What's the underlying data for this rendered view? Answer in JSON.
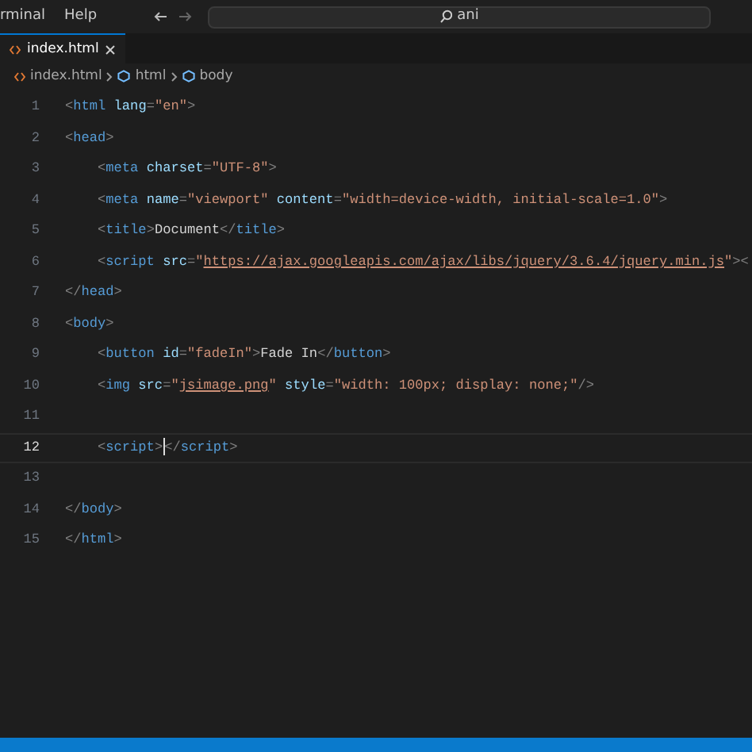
{
  "menu": [
    "rminal",
    "Help"
  ],
  "command_center": {
    "value": "ani"
  },
  "tabs": [
    {
      "label": "index.html",
      "selected": true
    }
  ],
  "breadcrumb": [
    "index.html",
    "html",
    "body"
  ],
  "lines": [
    {
      "number": "1",
      "selected": false,
      "tokens": [
        {
          "kind": "punct",
          "text": "<"
        },
        {
          "kind": "tag",
          "text": "html"
        },
        {
          "kind": "attr",
          "text": " lang"
        },
        {
          "kind": "punct",
          "text": "="
        },
        {
          "kind": "string",
          "text": "\"en\""
        },
        {
          "kind": "punct",
          "text": ">"
        }
      ]
    },
    {
      "number": "2",
      "selected": false,
      "tokens": [
        {
          "kind": "punct",
          "text": "<"
        },
        {
          "kind": "tag",
          "text": "head"
        },
        {
          "kind": "punct",
          "text": ">"
        }
      ]
    },
    {
      "number": "3",
      "selected": false,
      "tokens": [
        {
          "kind": "punct",
          "text": "    <"
        },
        {
          "kind": "tag",
          "text": "meta"
        },
        {
          "kind": "attr",
          "text": " charset"
        },
        {
          "kind": "punct",
          "text": "="
        },
        {
          "kind": "string",
          "text": "\"UTF-8\""
        },
        {
          "kind": "punct",
          "text": ">"
        }
      ]
    },
    {
      "number": "4",
      "selected": false,
      "tokens": [
        {
          "kind": "punct",
          "text": "    <"
        },
        {
          "kind": "tag",
          "text": "meta"
        },
        {
          "kind": "attr",
          "text": " name"
        },
        {
          "kind": "punct",
          "text": "="
        },
        {
          "kind": "string",
          "text": "\"viewport\""
        },
        {
          "kind": "attr",
          "text": " content"
        },
        {
          "kind": "punct",
          "text": "="
        },
        {
          "kind": "string",
          "text": "\"width=device-width, initial-scale=1.0\""
        },
        {
          "kind": "punct",
          "text": ">"
        }
      ]
    },
    {
      "number": "5",
      "selected": false,
      "tokens": [
        {
          "kind": "punct",
          "text": "    <"
        },
        {
          "kind": "tag",
          "text": "title"
        },
        {
          "kind": "punct",
          "text": ">"
        },
        {
          "kind": "text",
          "text": "Document"
        },
        {
          "kind": "punct",
          "text": "</"
        },
        {
          "kind": "tag",
          "text": "title"
        },
        {
          "kind": "punct",
          "text": ">"
        }
      ]
    },
    {
      "number": "6",
      "selected": false,
      "tokens": [
        {
          "kind": "punct",
          "text": "    <"
        },
        {
          "kind": "tag",
          "text": "script"
        },
        {
          "kind": "attr",
          "text": " src"
        },
        {
          "kind": "punct",
          "text": "="
        },
        {
          "kind": "string",
          "text": "\""
        },
        {
          "kind": "link",
          "text": "https://ajax.googleapis.com/ajax/libs/jquery/3.6.4/jquery.min.js"
        },
        {
          "kind": "string",
          "text": "\""
        },
        {
          "kind": "punct",
          "text": "><"
        }
      ]
    },
    {
      "number": "7",
      "selected": false,
      "tokens": [
        {
          "kind": "punct",
          "text": "</"
        },
        {
          "kind": "tag",
          "text": "head"
        },
        {
          "kind": "punct",
          "text": ">"
        }
      ]
    },
    {
      "number": "8",
      "selected": false,
      "tokens": [
        {
          "kind": "punct",
          "text": "<"
        },
        {
          "kind": "tag",
          "text": "body"
        },
        {
          "kind": "punct",
          "text": ">"
        }
      ]
    },
    {
      "number": "9",
      "selected": false,
      "tokens": [
        {
          "kind": "punct",
          "text": "    <"
        },
        {
          "kind": "tag",
          "text": "button"
        },
        {
          "kind": "attr",
          "text": " id"
        },
        {
          "kind": "punct",
          "text": "="
        },
        {
          "kind": "string",
          "text": "\"fadeIn\""
        },
        {
          "kind": "punct",
          "text": ">"
        },
        {
          "kind": "text",
          "text": "Fade In"
        },
        {
          "kind": "punct",
          "text": "</"
        },
        {
          "kind": "tag",
          "text": "button"
        },
        {
          "kind": "punct",
          "text": ">"
        }
      ]
    },
    {
      "number": "10",
      "selected": false,
      "tokens": [
        {
          "kind": "punct",
          "text": "    <"
        },
        {
          "kind": "tag",
          "text": "img"
        },
        {
          "kind": "attr",
          "text": " src"
        },
        {
          "kind": "punct",
          "text": "="
        },
        {
          "kind": "string",
          "text": "\""
        },
        {
          "kind": "link",
          "text": "jsimage.png"
        },
        {
          "kind": "string",
          "text": "\""
        },
        {
          "kind": "attr",
          "text": " style"
        },
        {
          "kind": "punct",
          "text": "="
        },
        {
          "kind": "string",
          "text": "\"width: 100px; display: none;\""
        },
        {
          "kind": "punct",
          "text": "/>"
        }
      ]
    },
    {
      "number": "11",
      "selected": false
    },
    {
      "number": "12",
      "selected": true,
      "tokens": [
        {
          "kind": "punct",
          "text": "    <"
        },
        {
          "kind": "tag",
          "text": "script"
        },
        {
          "kind": "punct",
          "text": ">"
        },
        {
          "kind": "cursor"
        },
        {
          "kind": "punct",
          "text": "</"
        },
        {
          "kind": "tag",
          "text": "script"
        },
        {
          "kind": "punct",
          "text": ">"
        }
      ]
    },
    {
      "number": "13",
      "selected": false
    },
    {
      "number": "14",
      "selected": false,
      "tokens": [
        {
          "kind": "punct",
          "text": "</"
        },
        {
          "kind": "tag",
          "text": "body"
        },
        {
          "kind": "punct",
          "text": ">"
        }
      ]
    },
    {
      "number": "15",
      "selected": false,
      "tokens": [
        {
          "kind": "punct",
          "text": "</"
        },
        {
          "kind": "tag",
          "text": "html"
        },
        {
          "kind": "punct",
          "text": ">"
        }
      ]
    }
  ]
}
